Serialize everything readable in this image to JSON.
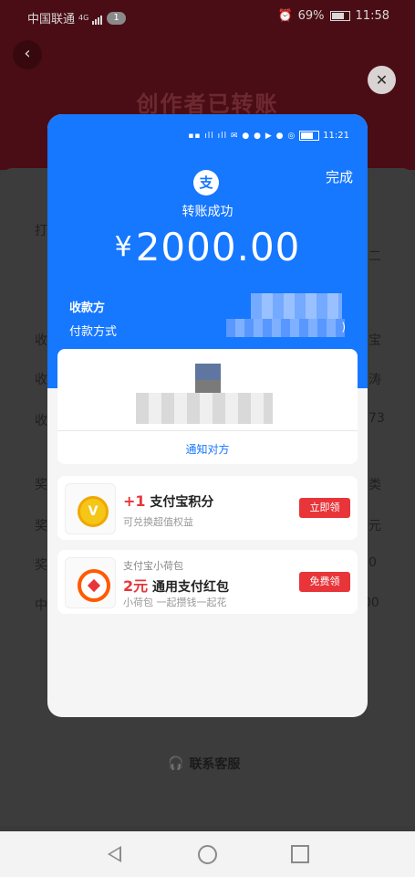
{
  "status_bar": {
    "carrier": "中国联通",
    "network": "4G",
    "notification_count": "1",
    "battery": "69%",
    "time": "11:58"
  },
  "background_page": {
    "title": "创作者已转账",
    "support_link": "联系客服",
    "side_fragments_left": [
      "打",
      "收",
      "收",
      "收",
      "奖",
      "奖",
      "奖",
      "中"
    ],
    "side_fragments_right": [
      "二",
      "宝",
      "涛",
      "73",
      "类",
      "元",
      "0",
      "00"
    ]
  },
  "receipt": {
    "inner_time": "11:21",
    "done_label": "完成",
    "logo_char": "支",
    "status_text": "转账成功",
    "currency": "¥",
    "amount": "2000.00",
    "payee_label": "收款方",
    "payment_method_label": "付款方式",
    "payment_method_suffix": ")",
    "notify_label": "通知对方"
  },
  "promos": [
    {
      "icon": "points-coin-icon",
      "prefix": "+1",
      "title": "支付宝积分",
      "subtitle": "可兑换超值权益",
      "cta": "立即领"
    },
    {
      "icon": "red-packet-icon",
      "small_title": "支付宝小荷包",
      "prefix": "2元",
      "title": "通用支付红包",
      "subtitle": "小荷包 一起攒钱一起花",
      "cta": "免费领"
    }
  ],
  "colors": {
    "alipay_blue": "#1677ff",
    "accent_red": "#e8353a",
    "header_dim": "#4a0d15"
  }
}
